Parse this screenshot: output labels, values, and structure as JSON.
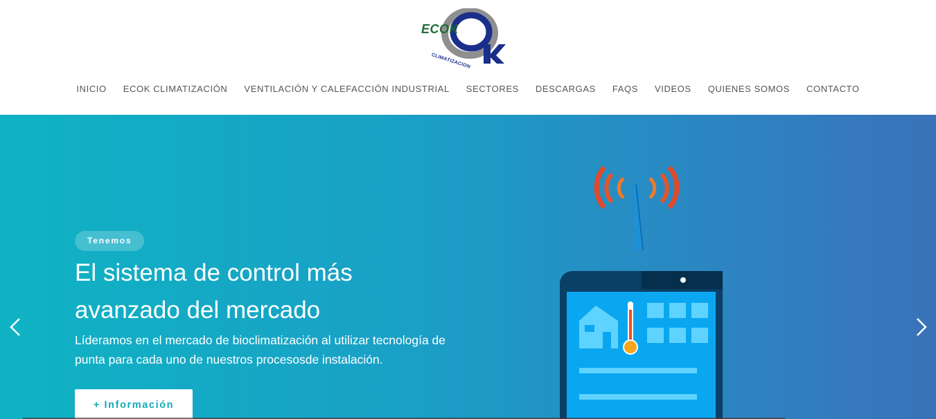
{
  "brand": {
    "logo_text": "ECOK",
    "logo_sub": "CLIMATIZACION",
    "colors": {
      "green": "#1e6b3a",
      "blue": "#1a2f8a",
      "gray_ring": "#8f8f8f"
    }
  },
  "nav": {
    "items": [
      {
        "label": "INICIO"
      },
      {
        "label": "ECOK CLIMATIZACIÓN"
      },
      {
        "label": "VENTILACIÓN Y CALEFACCIÓN INDUSTRIAL"
      },
      {
        "label": "SECTORES"
      },
      {
        "label": "DESCARGAS"
      },
      {
        "label": "FAQS"
      },
      {
        "label": "VIDEOS"
      },
      {
        "label": "QUIENES SOMOS"
      },
      {
        "label": "CONTACTO"
      }
    ]
  },
  "hero": {
    "badge": "Tenemos",
    "headline_line1": "El sistema de control más",
    "headline_line2": "avanzado del mercado",
    "description_line1": "Líderamos en el mercado de bioclimatización al utilizar tecnología de",
    "description_line2": "punta para cada uno de nuestros procesosde instalación.",
    "button_label": "+ Información",
    "colors": {
      "gradient_start": "#0fb3c4",
      "gradient_end": "#3a72b8",
      "button_text": "#12aab8"
    },
    "icons": [
      "chevron-left-icon",
      "chevron-right-icon",
      "antenna-signal-icon",
      "tablet-icon",
      "house-icon",
      "thermometer-icon"
    ]
  }
}
